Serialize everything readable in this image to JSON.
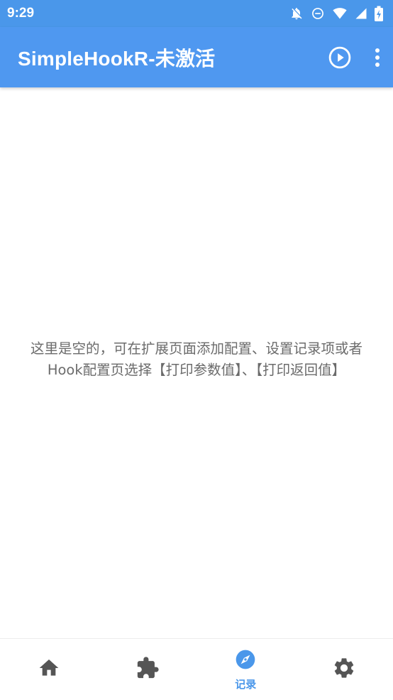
{
  "status_bar": {
    "time": "9:29",
    "icons": [
      "notifications-off-icon",
      "do-not-disturb-icon",
      "wifi-icon",
      "signal-icon",
      "battery-charging-icon"
    ]
  },
  "app_bar": {
    "title": "SimpleHookR-未激活",
    "actions": [
      "play-circle-icon",
      "more-vert-icon"
    ]
  },
  "main": {
    "empty_message_line1": "这里是空的，可在扩展页面添加配置、设置记录项或者",
    "empty_message_line2": "Hook配置页选择【打印参数值】、【打印返回值】"
  },
  "bottom_nav": {
    "items": [
      {
        "icon": "home-icon",
        "label": "",
        "active": false
      },
      {
        "icon": "extension-icon",
        "label": "",
        "active": false
      },
      {
        "icon": "explore-icon",
        "label": "记录",
        "active": true
      },
      {
        "icon": "settings-icon",
        "label": "",
        "active": false
      }
    ],
    "active_color": "#4a97ea",
    "inactive_color": "#555555"
  },
  "colors": {
    "primary": "#4f98f0",
    "status_bar": "#4a97ea",
    "text_secondary": "#6b6b6b"
  }
}
